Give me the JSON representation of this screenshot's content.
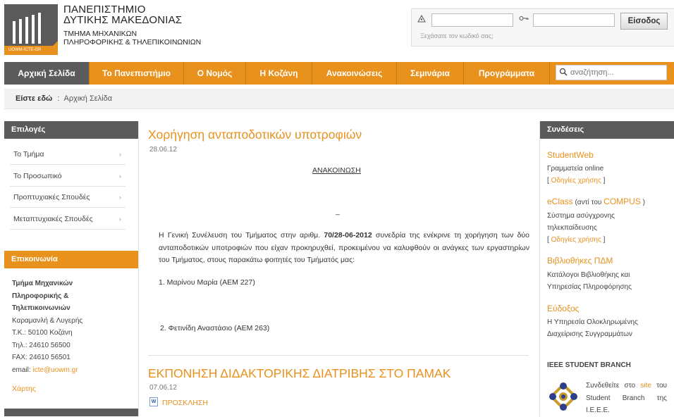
{
  "header": {
    "university_line1": "ΠΑΝΕΠΙΣΤΗΜΙΟ",
    "university_line2": "ΔΥΤΙΚΗΣ ΜΑΚΕΔΟΝΙΑΣ",
    "dept_line1": "ΤΜΗΜΑ ΜΗΧΑΝΙΚΩΝ",
    "dept_line2": "ΠΛΗΡΟΦΟΡΙΚΗΣ & ΤΗΛΕΠΙΚΟΙΝΩΝΙΩΝ",
    "logo_caption": "UOWM-ICTE-GR"
  },
  "login": {
    "user_icon": "user-icon",
    "key_icon": "key-icon",
    "username_value": "",
    "password_value": "",
    "button_label": "Είσοδος",
    "forgot_text": "Ξεχάσατε τον κωδικό σας;"
  },
  "nav": {
    "items": [
      {
        "label": "Αρχική Σελίδα",
        "active": true
      },
      {
        "label": "Το Πανεπιστήμιο"
      },
      {
        "label": "Ο Νομός"
      },
      {
        "label": "Η Κοζάνη"
      },
      {
        "label": "Ανακοινώσεις"
      },
      {
        "label": "Σεμινάρια"
      },
      {
        "label": "Προγράμματα"
      }
    ],
    "search_placeholder": "αναζήτηση..."
  },
  "breadcrumb": {
    "prefix": "Είστε εδώ",
    "separator": ":",
    "current": "Αρχική Σελίδα"
  },
  "left_sidebar": {
    "options_title": "Επιλογές",
    "menu": [
      {
        "label": "Το Τμήμα"
      },
      {
        "label": "Το Προσωπικό"
      },
      {
        "label": "Προπτυχιακές Σπουδές"
      },
      {
        "label": "Μεταπτυχιακές Σπουδές"
      }
    ],
    "contact_title": "Επικοινωνία",
    "contact": {
      "name_line1": "Τμήμα Μηχανικών",
      "name_line2": "Πληροφορικής &",
      "name_line3": "Τηλεπικοινωνιών",
      "address": "Καραμανλή & Λυγερής",
      "postal": "Τ.Κ.: 50100 Κοζάνη",
      "phone": "Τηλ.: 24610 56500",
      "fax": "FAX: 24610 56501",
      "email_label": "email:",
      "email": "icte@uowm.gr"
    },
    "map_link": "Χάρτης"
  },
  "main": {
    "post1": {
      "title": "Χορήγηση ανταποδοτικών υποτροφιών",
      "date": "28.06.12",
      "announcement_label": "ΑΝΑΚΟΙΝΩΣΗ",
      "dash": "_",
      "para_part1": "Η Γενική Συνέλευση του Τμήματος στην αριθμ. ",
      "para_bold": "70/28-06-2012",
      "para_part2": " συνεδρία της ενέκρινε τη χορήγηση των δύο ανταποδοτικών υποτροφιών που είχαν προκηρυχθεί, προκειμένου να καλυφθούν οι ανάγκες των εργαστηρίων του Τμήματος, στους παρακάτω φοιτητές του Τμήματός μας:",
      "item1": "1. Μαρίνου Μαρία (ΑΕΜ 227)",
      "item2": "2. Φετινίδη Αναστάσιο (ΑΕΜ 263)"
    },
    "post2": {
      "title": "ΕΚΠΟΝΗΣΗ ΔΙΔΑΚΤΟΡΙΚΗΣ ΔΙΑΤΡΙΒΗΣ ΣΤΟ ΠΑΜΑΚ",
      "date": "07.06.12",
      "doc_icon": "word-document-icon",
      "attachment": "ΠΡΟΣΚΛΗΣΗ"
    }
  },
  "right_sidebar": {
    "title": "Συνδέσεις",
    "links": {
      "studentweb": "StudentWeb",
      "studentweb_desc": "Γραμματεία online",
      "studentweb_guide_open": "[ ",
      "studentweb_guide": "Οδηγίες χρήσης",
      "studentweb_guide_close": " ]",
      "eclass": "eClass",
      "eclass_mid": " (αντί του ",
      "compus": "COMPUS",
      "eclass_end": " )",
      "eclass_desc1": "Σύστημα ασύγχρονης",
      "eclass_desc2": "τηλεκπαίδευσης",
      "eclass_guide_open": "[ ",
      "eclass_guide": "Οδηγίες χρήσης",
      "eclass_guide_close": " ]",
      "libraries": "Βιβλιοθήκες ΠΔΜ",
      "libraries_desc1": "Κατάλογοι Βιβλιοθήκης και",
      "libraries_desc2": "Υπηρεσίας Πληροφόρησης",
      "eudoxus": "Εύδοξος",
      "eudoxus_desc1": "Η Υπηρεσία Ολοκληρωμένης",
      "eudoxus_desc2": "Διαχείρισης Συγγραμμάτων"
    },
    "ieee": {
      "title": "IEEE STUDENT BRANCH",
      "logo_icon": "ieee-branch-logo",
      "text_part1": "Συνδεθείτε στο ",
      "site_link": "site",
      "text_part2": " του Student Branch της I.E.E.E."
    }
  },
  "colors": {
    "accent": "#e8911c",
    "dark_gray": "#5b5b5b"
  }
}
